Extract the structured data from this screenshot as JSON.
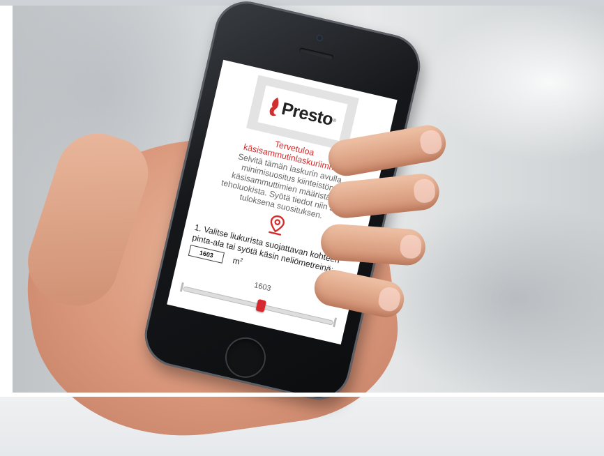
{
  "brand": {
    "name": "Presto",
    "reg_mark": "®",
    "flame_color": "#d22e2e"
  },
  "welcome": {
    "line1": "Tervetuloa",
    "line2": "käsisammutinlaskuriimme"
  },
  "intro": "Selvitä tämän laskurin avulla minimisuositus kiinteistön käsisammuttimien määristä ja teholuokista. Syötä tiedot niin saat tuloksena suosituksen.",
  "icons": {
    "location": "location-pin-icon"
  },
  "step1": {
    "label": "1. Valitse liukurista suojattavan kohteen pinta-ala tai syötä käsin neliömetreinä:",
    "value": "1603",
    "unit": "m",
    "unit_sup": "2"
  },
  "slider": {
    "value_label": "1603",
    "fraction": 0.52
  },
  "colors": {
    "accent": "#d22e2e",
    "thumb": "#d7282f"
  }
}
